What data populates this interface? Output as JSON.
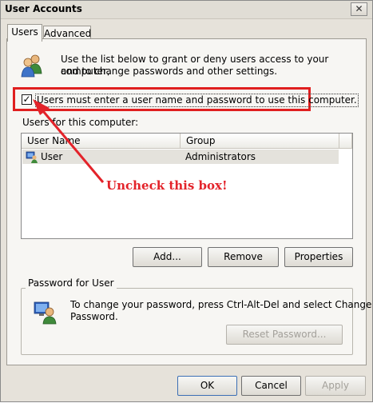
{
  "window": {
    "title": "User Accounts",
    "close_glyph": "✕"
  },
  "tabs": [
    {
      "label": "Users",
      "active": true
    },
    {
      "label": "Advanced",
      "active": false
    }
  ],
  "intro": {
    "line1": "Use the list below to grant or deny users access to your computer,",
    "line2": "and to change passwords and other settings.",
    "icon": "users-icon"
  },
  "login_required": {
    "checked": true,
    "check_glyph": "✓",
    "label": "Users must enter a user name and password to use this computer."
  },
  "users_list": {
    "label": "Users for this computer:",
    "columns": [
      "User Name",
      "Group"
    ],
    "rows": [
      {
        "user": "User",
        "group": "Administrators",
        "icon": "user-icon"
      }
    ]
  },
  "buttons": {
    "add": "Add...",
    "remove": "Remove",
    "properties": "Properties"
  },
  "password_group": {
    "title": "Password for User",
    "line1": "To change your password, press Ctrl-Alt-Del and select Change",
    "line2": "Password.",
    "reset_button": "Reset Password...",
    "icon": "user-password-icon"
  },
  "annotation": {
    "text": "Uncheck this box!",
    "color": "#e3232a"
  },
  "dialog_buttons": {
    "ok": "OK",
    "cancel": "Cancel",
    "apply": "Apply"
  },
  "colors": {
    "highlight": "#e01f1f",
    "window_bg": "#e6e2da",
    "panel_bg": "#f7f6f3"
  }
}
